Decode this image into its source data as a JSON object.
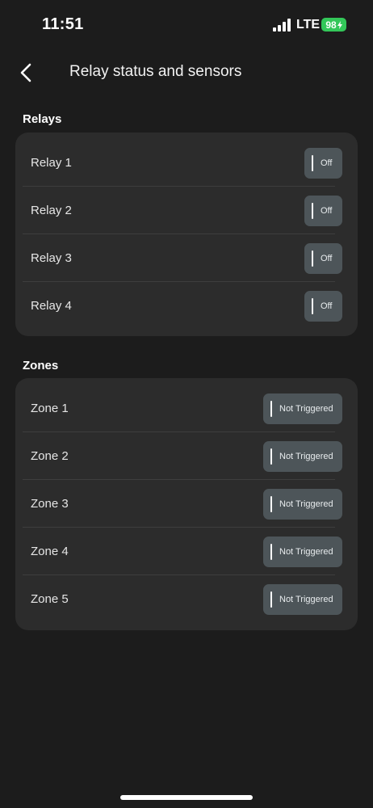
{
  "status_bar": {
    "time": "11:51",
    "network": "LTE",
    "battery": "98"
  },
  "header": {
    "title": "Relay status and sensors"
  },
  "relays": {
    "title": "Relays",
    "items": [
      {
        "label": "Relay 1",
        "state": "Off"
      },
      {
        "label": "Relay 2",
        "state": "Off"
      },
      {
        "label": "Relay 3",
        "state": "Off"
      },
      {
        "label": "Relay 4",
        "state": "Off"
      }
    ]
  },
  "zones": {
    "title": "Zones",
    "items": [
      {
        "label": "Zone 1",
        "state": "Not Triggered"
      },
      {
        "label": "Zone 2",
        "state": "Not Triggered"
      },
      {
        "label": "Zone 3",
        "state": "Not Triggered"
      },
      {
        "label": "Zone 4",
        "state": "Not Triggered"
      },
      {
        "label": "Zone 5",
        "state": "Not Triggered"
      }
    ]
  },
  "colors": {
    "background": "#1c1c1c",
    "card": "#2c2c2c",
    "pill": "#4d5559",
    "battery": "#33c759"
  },
  "icons": {
    "back": "chevron-left-icon",
    "signal": "cellular-signal-icon",
    "battery": "battery-icon"
  }
}
